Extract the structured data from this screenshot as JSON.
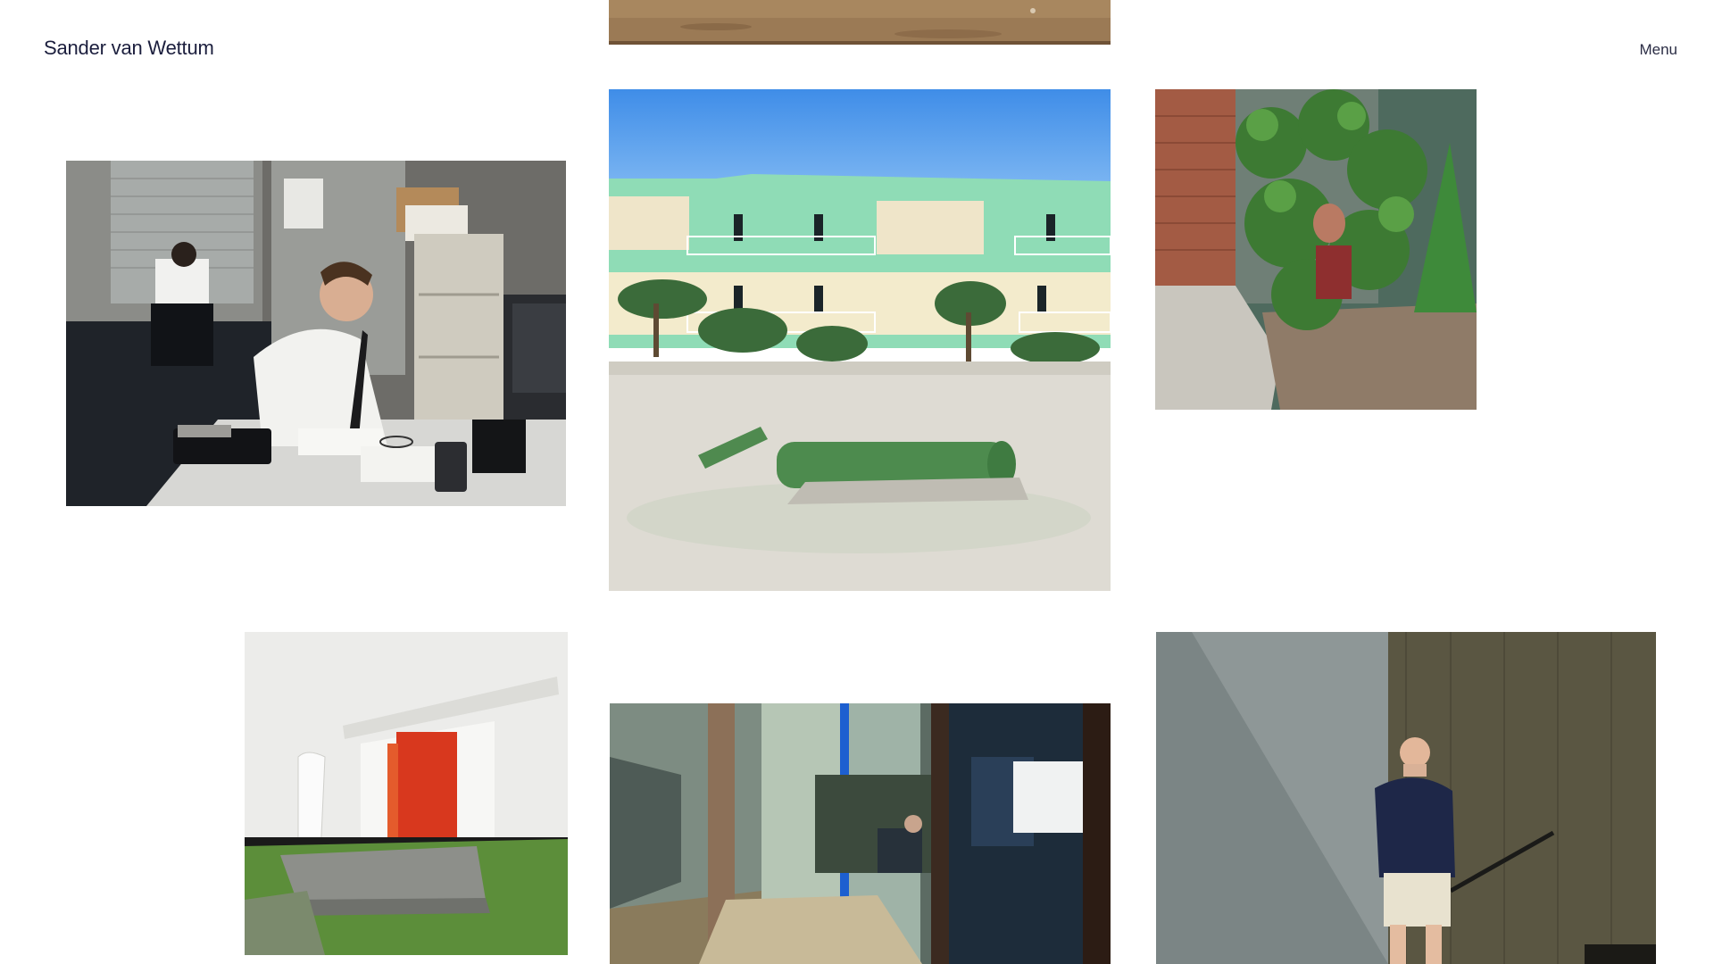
{
  "header": {
    "site_title": "Sander van Wettum",
    "menu_label": "Menu"
  },
  "gallery": {
    "photos": [
      {
        "subject": "desert ground"
      },
      {
        "subject": "man at office desk"
      },
      {
        "subject": "green hotel with rolled turf"
      },
      {
        "subject": "person hiding in shrub"
      },
      {
        "subject": "white wall with red door"
      },
      {
        "subject": "glass office corridor"
      },
      {
        "subject": "elderly man by marble wall"
      }
    ]
  },
  "colors": {
    "text": "#1b1e3d",
    "background": "#ffffff"
  }
}
